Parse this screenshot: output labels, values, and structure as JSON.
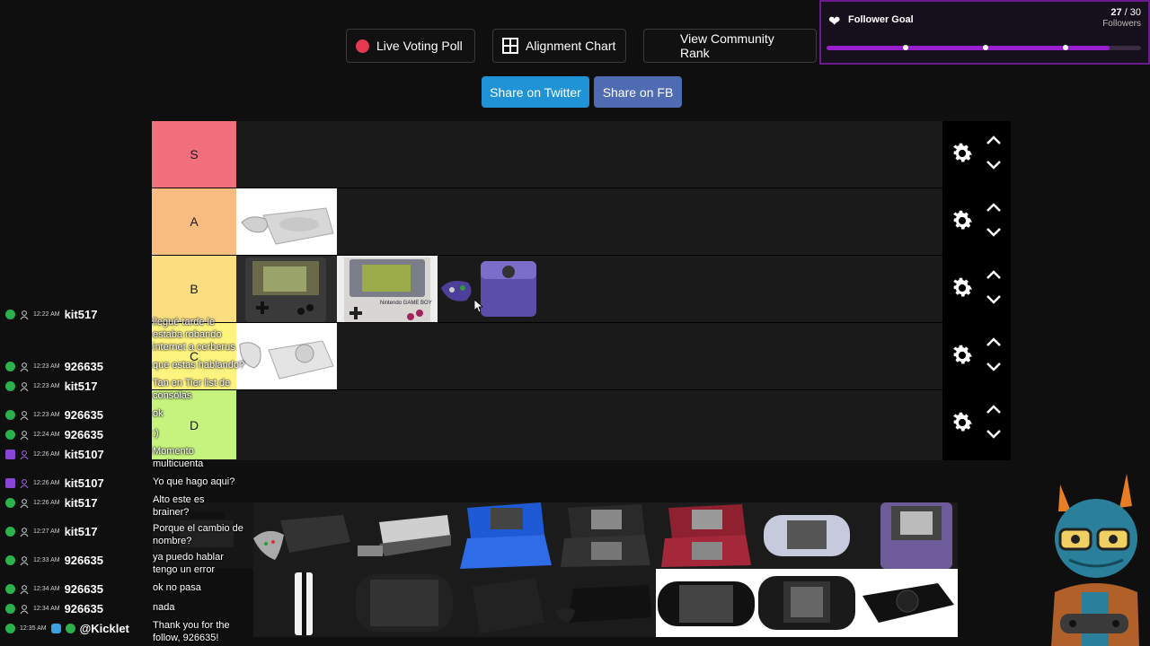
{
  "top_buttons": {
    "live_poll": "Live Voting Poll",
    "alignment": "Alignment Chart",
    "community_rank": "View Community Rank"
  },
  "share": {
    "twitter": "Share on Twitter",
    "facebook": "Share on FB"
  },
  "follower_goal": {
    "title": "Follower Goal",
    "current": "27",
    "target": "/ 30",
    "unit": "Followers",
    "progress": 0.9
  },
  "tiers": [
    {
      "label": "S",
      "color": "#f2707e"
    },
    {
      "label": "A",
      "color": "#f8bc80"
    },
    {
      "label": "B",
      "color": "#fbde80"
    },
    {
      "label": "C",
      "color": "#fdf37f"
    },
    {
      "label": "D",
      "color": "#c6f27e"
    }
  ],
  "chat": {
    "lines": [
      {
        "time": "12:22 AM",
        "user": "kit517",
        "badge": "green"
      },
      {
        "time": "12:23 AM",
        "user": "926635",
        "badge": "green"
      },
      {
        "time": "12:23 AM",
        "user": "kit517",
        "badge": "green"
      },
      {
        "time": "12:23 AM",
        "user": "926635",
        "badge": "green"
      },
      {
        "time": "12:24 AM",
        "user": "926635",
        "badge": "green"
      },
      {
        "time": "12:26 AM",
        "user": "kit5107",
        "badge": "twitch"
      },
      {
        "time": "12:26 AM",
        "user": "kit5107",
        "badge": "twitch"
      },
      {
        "time": "12:26 AM",
        "user": "kit517",
        "badge": "green"
      },
      {
        "time": "12:27 AM",
        "user": "kit517",
        "badge": "green"
      },
      {
        "time": "12:33 AM",
        "user": "926635",
        "badge": "green"
      },
      {
        "time": "12:34 AM",
        "user": "926635",
        "badge": "green"
      },
      {
        "time": "12:34 AM",
        "user": "926635",
        "badge": "green"
      },
      {
        "time": "12:35 AM",
        "user": "@Kicklet",
        "badge": "green"
      }
    ],
    "messages": [
      "llegué tarde le",
      "estaba robando",
      "internet a cerberus",
      "que estas hablando?",
      "Tan en Tier list de",
      "consolas",
      "ok",
      ":)",
      "Momento",
      "multicuenta",
      "Yo que hago aqui?",
      "Alto este es",
      "brainer?",
      "Porque el cambio de",
      "nombre?",
      "ya puedo hablar",
      "tengo un error",
      "ok no pasa",
      "nada",
      "Thank you for the",
      "follow, 926635!"
    ]
  }
}
